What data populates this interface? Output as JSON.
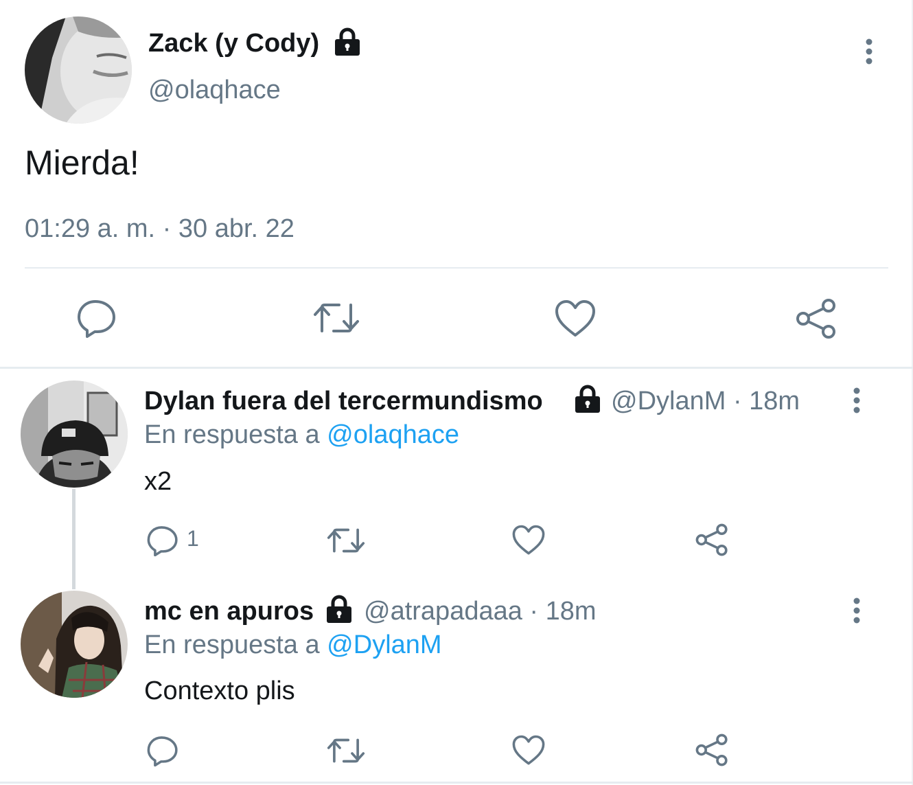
{
  "main_tweet": {
    "display_name": "Zack (y Cody)",
    "handle": "@olaqhace",
    "text": "Mierda!",
    "timestamp": "01:29 a. m. · 30 abr. 22",
    "locked": true,
    "actions": [
      "reply",
      "retweet",
      "like",
      "share"
    ]
  },
  "replies": [
    {
      "display_name": "Dylan fuera del tercermundismo",
      "handle": "@DylanM",
      "time": "· 18m",
      "reply_prefix": "En respuesta a",
      "reply_to": "@olaqhace",
      "text": "x2",
      "reply_count": "1",
      "locked": true
    },
    {
      "display_name": "mc en apuros",
      "handle": "@atrapadaaa",
      "time": "· 18m",
      "reply_prefix": "En respuesta a",
      "reply_to": "@DylanM",
      "text": "Contexto plis",
      "reply_count": "",
      "locked": true
    }
  ],
  "icons": {
    "lock": "lock-icon",
    "more": "more-vertical-icon",
    "reply": "reply-icon",
    "retweet": "retweet-icon",
    "like": "heart-icon",
    "share": "share-icon"
  },
  "colors": {
    "text": "#14171a",
    "muted": "#657786",
    "link": "#1da1f2",
    "divider": "#e6ecf0"
  }
}
